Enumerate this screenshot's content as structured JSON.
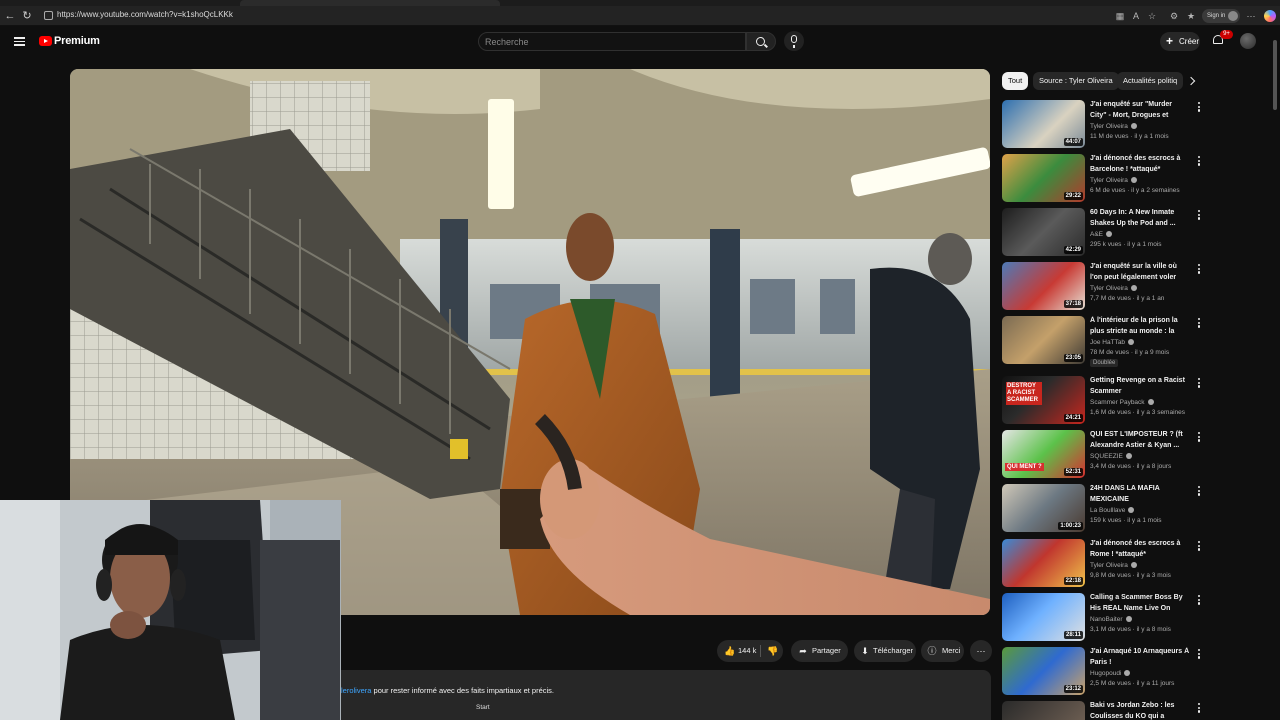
{
  "browser": {
    "url": "https://www.youtube.com/watch?v=k1shoQcLKKk",
    "signin_label": "Sign in"
  },
  "header": {
    "logo_text": "Premium",
    "search_placeholder": "Recherche",
    "search_value": "",
    "create_label": "Créer",
    "notification_count": "9+"
  },
  "video": {
    "like_count": "144 k",
    "share_label": "Partager",
    "download_label": "Télécharger",
    "thanks_label": "Merci"
  },
  "description": {
    "link_text": "lerolivera",
    "text": " pour rester informé avec des faits impartiaux et précis.",
    "start_label": "Start"
  },
  "chips": [
    {
      "label": "Tout",
      "active": true
    },
    {
      "label": "Source : Tyler Oliveira",
      "active": false
    },
    {
      "label": "Actualités politiq",
      "active": false
    }
  ],
  "recommendations": [
    {
      "title": "J'ai enquêté sur \"Murder City\" - Mort, Drogues et Tueurs en ...",
      "channel": "Tyler Oliveira",
      "meta": "11 M de vues · il y a 1 mois",
      "duration": "44:07",
      "badge": ""
    },
    {
      "title": "J'ai dénoncé des escrocs à Barcelone ! *attaqué*",
      "channel": "Tyler Oliveira",
      "meta": "6 M de vues · il y a 2 semaines",
      "duration": "29:22",
      "badge": ""
    },
    {
      "title": "60 Days In: A New Inmate Shakes Up the Pod and ...",
      "channel": "A&E",
      "meta": "295 k vues · il y a 1 mois",
      "duration": "42:29",
      "badge": ""
    },
    {
      "title": "J'ai enquêté sur la ville où l'on peut légalement voler des ...",
      "channel": "Tyler Oliveira",
      "meta": "7,7 M de vues · il y a 1 an",
      "duration": "37:18",
      "badge": ""
    },
    {
      "title": "À l'intérieur de la prison la plus stricte au monde : la guerre ...",
      "channel": "Joe HaTTab",
      "meta": "78 M de vues · il y a 9 mois",
      "duration": "23:05",
      "badge": "Doublée"
    },
    {
      "title": "Getting Revenge on a Racist Scammer",
      "channel": "Scammer Payback",
      "meta": "1,6 M de vues · il y a 3 semaines",
      "duration": "24:21",
      "badge": ""
    },
    {
      "title": "QUI EST L'IMPOSTEUR ? (ft Alexandre Astier & Kyan ...",
      "channel": "SQUEEZIE",
      "meta": "3,4 M de vues · il y a 8 jours",
      "duration": "52:31",
      "badge": ""
    },
    {
      "title": "24H DANS LA MAFIA MEXICAINE",
      "channel": "La Boulllave",
      "meta": "159 k vues · il y a 1 mois",
      "duration": "1:00:23",
      "badge": ""
    },
    {
      "title": "J'ai dénoncé des escrocs à Rome ! *attaqué*",
      "channel": "Tyler Oliveira",
      "meta": "9,8 M de vues · il y a 3 mois",
      "duration": "22:18",
      "badge": ""
    },
    {
      "title": "Calling a Scammer Boss By His REAL Name Live On CCTV!",
      "channel": "NanoBaiter",
      "meta": "3,1 M de vues · il y a 8 mois",
      "duration": "28:11",
      "badge": ""
    },
    {
      "title": "J'ai Arnaqué 10 Arnaqueurs À Paris !",
      "channel": "Hugopoudi",
      "meta": "2,5 M de vues · il y a 11 jours",
      "duration": "23:12",
      "badge": ""
    },
    {
      "title": "Baki vs Jordan Zebo : les Coulisses du KO qui a choqué ...",
      "channel": "",
      "meta": "",
      "duration": "",
      "badge": ""
    }
  ],
  "thumb_texts": {
    "t6": "DESTROY A RACIST SCAMMER",
    "t7": "QUI MENT ?"
  }
}
